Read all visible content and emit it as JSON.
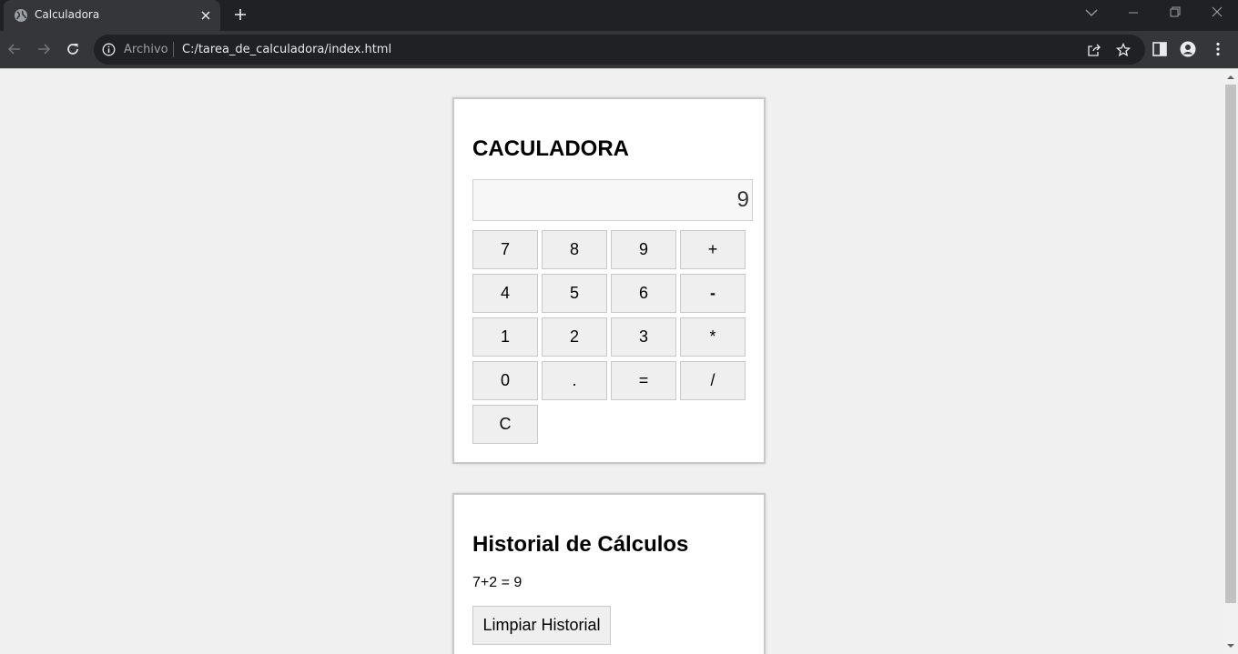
{
  "browser": {
    "tab_title": "Calculadora",
    "omnibox_scheme": "Archivo",
    "omnibox_url": "C:/tarea_de_calculadora/index.html"
  },
  "calculator": {
    "title": "CACULADORA",
    "display_value": "9",
    "keys": {
      "k7": "7",
      "k8": "8",
      "k9": "9",
      "plus": "+",
      "k4": "4",
      "k5": "5",
      "k6": "6",
      "minus": "-",
      "k1": "1",
      "k2": "2",
      "k3": "3",
      "multiply": "*",
      "k0": "0",
      "dot": ".",
      "equals": "=",
      "divide": "/",
      "clear": "C"
    }
  },
  "history": {
    "title": "Historial de Cálculos",
    "entries": [
      "7+2 = 9"
    ],
    "clear_label": "Limpiar Historial"
  }
}
